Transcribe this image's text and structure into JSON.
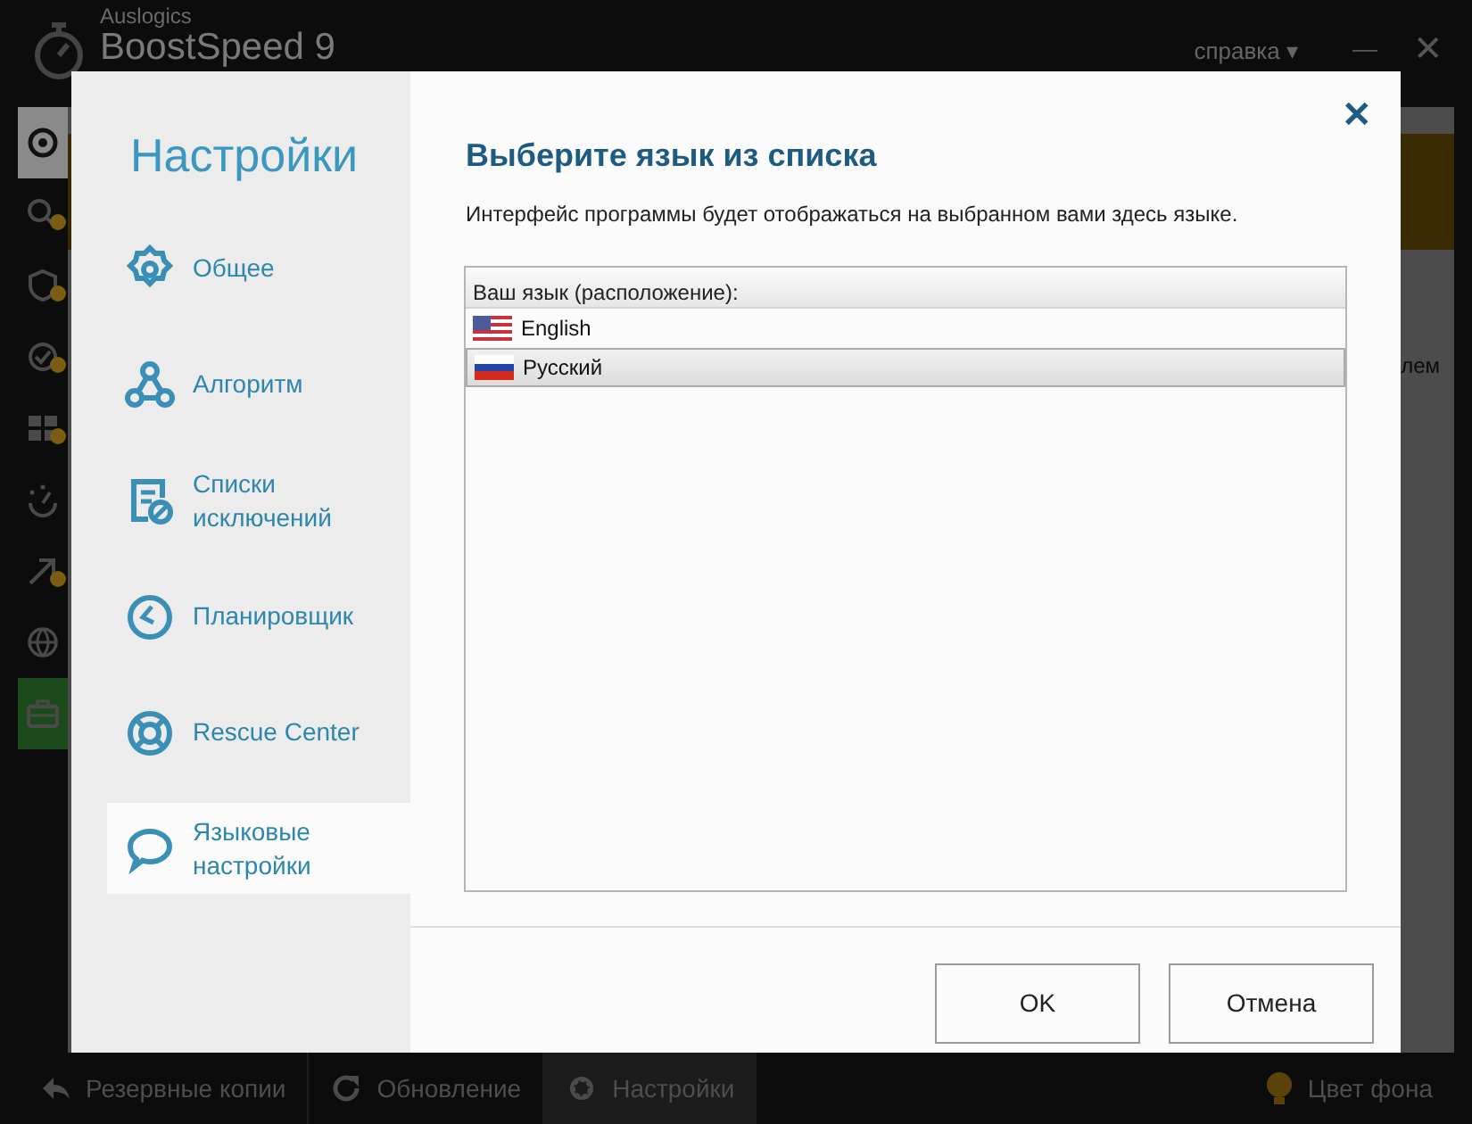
{
  "app": {
    "brand": "Auslogics",
    "product": "BoostSpeed 9",
    "help_menu": "справка",
    "help_caret": "▾",
    "minimize": "—",
    "close": "✕",
    "side_icons": [
      {
        "kind": "target",
        "selected": true,
        "badge": false
      },
      {
        "kind": "search",
        "selected": false,
        "badge": true
      },
      {
        "kind": "shield",
        "selected": false,
        "badge": true
      },
      {
        "kind": "check",
        "selected": false,
        "badge": true
      },
      {
        "kind": "windows",
        "selected": false,
        "badge": true
      },
      {
        "kind": "gauge",
        "selected": false,
        "badge": false
      },
      {
        "kind": "arrow",
        "selected": false,
        "badge": true
      },
      {
        "kind": "globe",
        "selected": false,
        "badge": false
      },
      {
        "kind": "briefcase",
        "selected": false,
        "badge": false,
        "active": true
      }
    ],
    "content_fragment": "лем",
    "bottom_bar": [
      {
        "kind": "backup",
        "label": "Резервные копии",
        "selected": false
      },
      {
        "kind": "update",
        "label": "Обновление",
        "selected": false
      },
      {
        "kind": "settings",
        "label": "Настройки",
        "selected": true
      }
    ],
    "background_color_button": "Цвет фона"
  },
  "dialog": {
    "title": "Настройки",
    "close": "✕",
    "nav": [
      {
        "kind": "general",
        "label": "Общее",
        "selected": false
      },
      {
        "kind": "algorithm",
        "label": "Алгоритм",
        "selected": false
      },
      {
        "kind": "exclusions",
        "label": "Списки исключений",
        "selected": false
      },
      {
        "kind": "scheduler",
        "label": "Планировщик",
        "selected": false
      },
      {
        "kind": "rescue",
        "label": "Rescue Center",
        "selected": false
      },
      {
        "kind": "language",
        "label": "Языковые настройки",
        "selected": true
      }
    ],
    "heading": "Выберите язык из списка",
    "description": "Интерфейс программы будет отображаться на выбранном вами здесь языке.",
    "list": {
      "column": "Ваш язык (расположение):",
      "rows": [
        {
          "kind": "us",
          "label": "English",
          "selected": false
        },
        {
          "kind": "ru",
          "label": "Русский",
          "selected": true
        }
      ]
    },
    "buttons": [
      {
        "label": "OK"
      },
      {
        "label": "Отмена"
      }
    ]
  }
}
